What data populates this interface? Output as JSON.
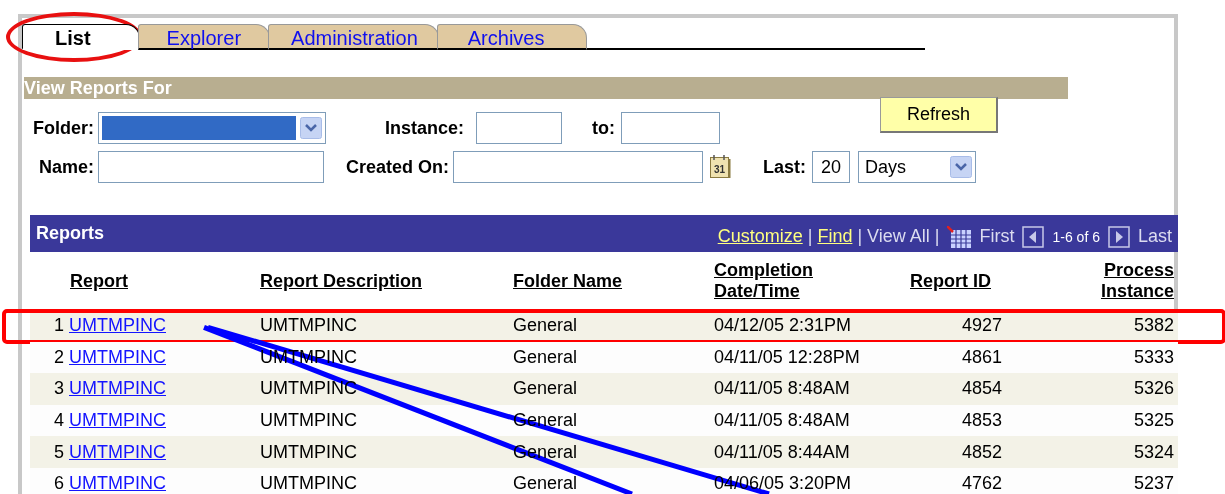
{
  "tabs": [
    {
      "label": "List",
      "selected": true,
      "circled": true
    },
    {
      "label": "Explorer",
      "selected": false,
      "circled": false
    },
    {
      "label": "Administration",
      "selected": false,
      "circled": false
    },
    {
      "label": "Archives",
      "selected": false,
      "circled": false
    }
  ],
  "filters": {
    "title": "View Reports For",
    "folder": {
      "label": "Folder:",
      "focused": true
    },
    "instance": {
      "label": "Instance:"
    },
    "to": {
      "label": "to:"
    },
    "refresh": "Refresh",
    "name": {
      "label": "Name:"
    },
    "created_on": {
      "label": "Created On:",
      "calendar": "31"
    },
    "last": {
      "label": "Last:",
      "value": "20",
      "unit": "Days"
    }
  },
  "reports": {
    "title": "Reports",
    "nav": [
      {
        "kind": "link",
        "text": "Customize"
      },
      {
        "kind": "sep",
        "text": "|"
      },
      {
        "kind": "link",
        "text": "Find"
      },
      {
        "kind": "sep",
        "text": "|"
      },
      {
        "kind": "text",
        "text": "View All"
      },
      {
        "kind": "sep",
        "text": "|"
      },
      {
        "kind": "grid"
      },
      {
        "kind": "text",
        "text": "First"
      },
      {
        "kind": "prev"
      },
      {
        "kind": "range",
        "text": "1-6 of 6"
      },
      {
        "kind": "next"
      },
      {
        "kind": "text",
        "text": "Last"
      }
    ],
    "columns": [
      "Report",
      "Report Description",
      "Folder Name",
      "Completion Date/Time",
      "Report ID",
      "Process Instance"
    ],
    "rows": [
      {
        "number": "1",
        "report": "UMTMPINC",
        "description": "UMTMPINC",
        "folder": "General",
        "completion": "04/12/05  2:31PM",
        "report_id": "4927",
        "process_instance": "5382",
        "boxed": true,
        "pointed": true
      },
      {
        "number": "2",
        "report": "UMTMPINC",
        "description": "UMTMPINC",
        "folder": "General",
        "completion": "04/11/05 12:28PM",
        "report_id": "4861",
        "process_instance": "5333",
        "boxed": false,
        "pointed": false
      },
      {
        "number": "3",
        "report": "UMTMPINC",
        "description": "UMTMPINC",
        "folder": "General",
        "completion": "04/11/05  8:48AM",
        "report_id": "4854",
        "process_instance": "5326",
        "boxed": false,
        "pointed": false
      },
      {
        "number": "4",
        "report": "UMTMPINC",
        "description": "UMTMPINC",
        "folder": "General",
        "completion": "04/11/05  8:48AM",
        "report_id": "4853",
        "process_instance": "5325",
        "boxed": false,
        "pointed": false
      },
      {
        "number": "5",
        "report": "UMTMPINC",
        "description": "UMTMPINC",
        "folder": "General",
        "completion": "04/11/05  8:44AM",
        "report_id": "4852",
        "process_instance": "5324",
        "boxed": false,
        "pointed": false
      },
      {
        "number": "6",
        "report": "UMTMPINC",
        "description": "UMTMPINC",
        "folder": "General",
        "completion": "04/06/05  3:20PM",
        "report_id": "4762",
        "process_instance": "5237",
        "boxed": false,
        "pointed": false
      }
    ]
  }
}
